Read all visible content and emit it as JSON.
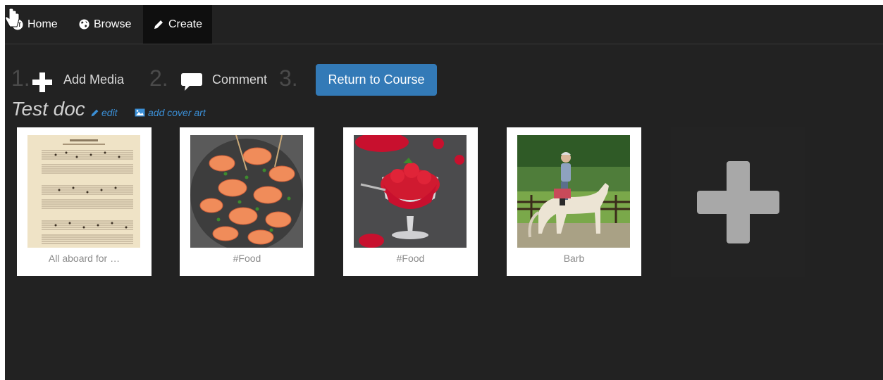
{
  "nav": {
    "home": "Home",
    "browse": "Browse",
    "create": "Create"
  },
  "steps": [
    {
      "number": "1.",
      "label": "Add Media",
      "icon": "plus-icon"
    },
    {
      "number": "2.",
      "label": "Comment",
      "icon": "comment-icon"
    },
    {
      "number": "3.",
      "label": "Return to Course"
    }
  ],
  "document": {
    "title": "Test doc",
    "edit_label": "edit",
    "cover_label": "add cover art"
  },
  "media": [
    {
      "caption": "All aboard for …",
      "kind": "sheet-music-image"
    },
    {
      "caption": "#Food",
      "kind": "shrimp-dish-image"
    },
    {
      "caption": "#Food",
      "kind": "strawberry-dessert-image"
    },
    {
      "caption": "Barb",
      "kind": "horse-rider-image"
    }
  ],
  "add_tile_icon": "plus-icon",
  "colors": {
    "background": "#222222",
    "accent": "#337ab7",
    "link": "#3b8fd6"
  }
}
